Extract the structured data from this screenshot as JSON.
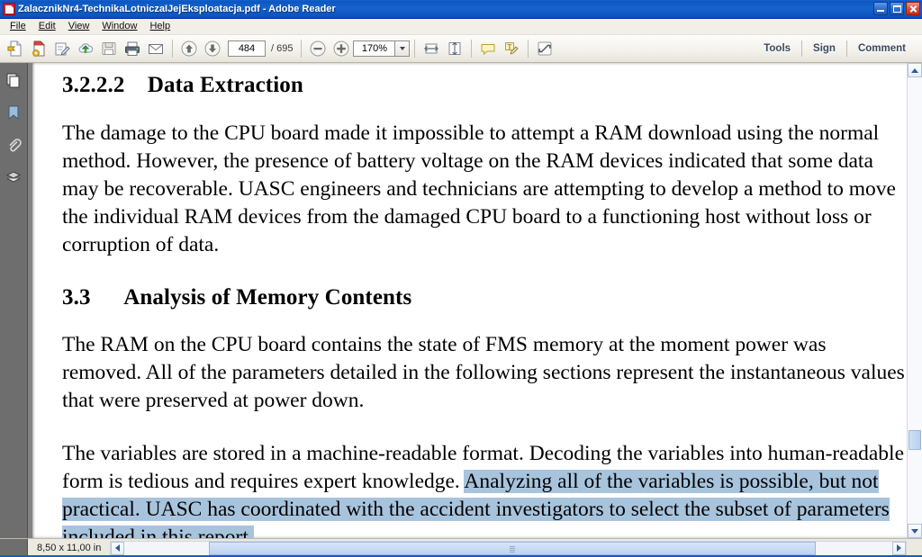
{
  "window": {
    "title": "ZalacznikNr4-TechnikaLotniczaIJejEksploatacja.pdf  -  Adobe Reader",
    "app_icon": "pdf-document-icon",
    "controls": {
      "minimize": "minimize-button",
      "restore": "restore-button",
      "close": "close-button"
    }
  },
  "menubar": {
    "items": [
      {
        "label": "File"
      },
      {
        "label": "Edit"
      },
      {
        "label": "View"
      },
      {
        "label": "Window"
      },
      {
        "label": "Help"
      }
    ]
  },
  "toolbar": {
    "buttons": [
      {
        "name": "open-file-icon",
        "title": "Open"
      },
      {
        "name": "create-pdf-icon",
        "title": "Create PDF"
      },
      {
        "name": "sign-document-icon",
        "title": "Sign"
      },
      {
        "name": "upload-cloud-icon",
        "title": "Send files"
      },
      {
        "name": "save-icon",
        "title": "Save"
      },
      {
        "name": "print-icon",
        "title": "Print"
      },
      {
        "name": "email-icon",
        "title": "Email"
      }
    ],
    "navigation": {
      "previous_page_icon": "arrow-up-icon",
      "next_page_icon": "arrow-down-icon",
      "current_page": "484",
      "page_separator": "/",
      "total_pages": "695"
    },
    "zoom": {
      "zoom_out_icon": "minus-circle-icon",
      "zoom_in_icon": "plus-circle-icon",
      "level": "170%",
      "dropdown_icon": "chevron-down-icon"
    },
    "view_buttons": [
      {
        "name": "fit-width-icon",
        "title": "Fit Width"
      },
      {
        "name": "fit-page-icon",
        "title": "Fit Page"
      }
    ],
    "comment_buttons": [
      {
        "name": "sticky-note-icon",
        "title": "Add sticky note"
      },
      {
        "name": "highlight-text-icon",
        "title": "Highlight text"
      }
    ],
    "fullscreen": {
      "name": "fullscreen-icon",
      "title": "Read Mode"
    },
    "right_items": [
      {
        "label": "Tools"
      },
      {
        "label": "Sign"
      },
      {
        "label": "Comment"
      }
    ]
  },
  "navpane": {
    "items": [
      {
        "name": "page-thumbnails-icon",
        "label": "Page Thumbnails"
      },
      {
        "name": "bookmarks-icon",
        "label": "Bookmarks"
      },
      {
        "name": "attachments-icon",
        "label": "Attachments"
      },
      {
        "name": "layers-icon",
        "label": "Layers"
      }
    ]
  },
  "document": {
    "heading1": "3.2.2.2    Data Extraction",
    "paragraph1": "The damage to the CPU board made it impossible to attempt a RAM download using the normal method. However, the presence of battery voltage on the RAM devices indicated that some data may be recoverable. UASC engineers and technicians are attempting to develop a method to move the individual RAM devices from the damaged CPU board to a functioning host without loss or corruption of data.",
    "heading2": "3.3      Analysis of Memory Contents",
    "paragraph2": "The RAM on the CPU board contains the state of FMS memory at the moment power was removed. All of the parameters detailed in the following sections represent the instantaneous values that were preserved at power down.",
    "paragraph3_plain": "The variables are stored in a machine-readable format. Decoding the variables into human-readable form is tedious and requires expert knowledge. ",
    "paragraph3_highlighted": "Analyzing all of the variables is possible, but not practical. UASC has coordinated with the accident investigators to select the subset of parameters included in this report.",
    "selection_color": "#a8c4dd"
  },
  "statusbar": {
    "page_dimensions": "8,50 x 11,00 in",
    "scroll_left_icon": "chevron-left-icon",
    "scroll_right_icon": "chevron-right-icon"
  },
  "scrollbar": {
    "up_icon": "scroll-up-arrow-icon",
    "down_icon": "scroll-down-arrow-icon"
  },
  "colors": {
    "titlebar": "#0a57c2",
    "toolbar": "#f4f2ec",
    "navpane": "#6e6e6e",
    "page": "#ffffff",
    "highlight": "#a8c4dd"
  }
}
